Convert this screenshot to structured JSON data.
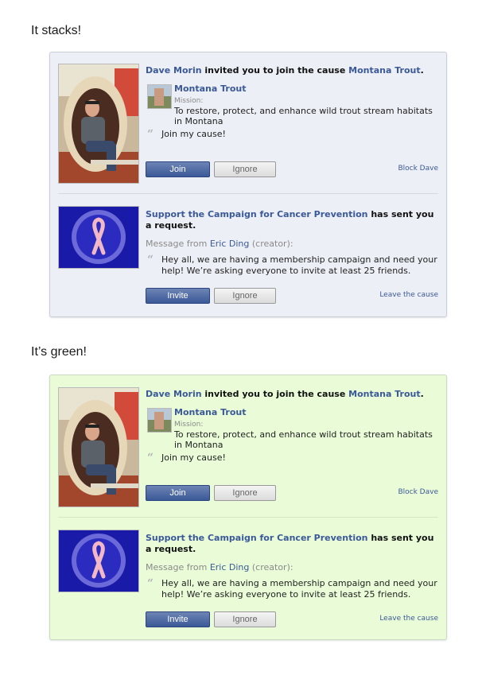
{
  "sections": [
    {
      "title": "It stacks!",
      "request1": {
        "inviter": "Dave Morin",
        "invite_text": " invited you to join the cause ",
        "cause_link": "Montana Trout",
        "cause_name": "Montana Trout",
        "mission_label": "Mission:",
        "mission_text": "To restore, protect, and enhance wild trout stream habitats in Montana",
        "quote": "Join my cause!",
        "primary_button": "Join",
        "secondary_button": "Ignore",
        "side_link": "Block Dave"
      },
      "request2": {
        "cause_link": "Support the Campaign for Cancer Prevention",
        "headline_suffix": " has sent you a request.",
        "message_from_prefix": "Message from ",
        "sender": "Eric Ding",
        "message_from_suffix": " (creator):",
        "quote": "Hey all, we are having a membership campaign and need your help! We’re asking everyone to invite at least 25 friends.",
        "primary_button": "Invite",
        "secondary_button": "Ignore",
        "side_link": "Leave the cause"
      }
    },
    {
      "title": "It’s green!",
      "request1": {
        "inviter": "Dave Morin",
        "invite_text": " invited you to join the cause ",
        "cause_link": "Montana Trout",
        "cause_name": "Montana Trout",
        "mission_label": "Mission:",
        "mission_text": "To restore, protect, and enhance wild trout stream habitats in Montana",
        "quote": "Join my cause!",
        "primary_button": "Join",
        "secondary_button": "Ignore",
        "side_link": "Block Dave"
      },
      "request2": {
        "cause_link": "Support the Campaign for Cancer Prevention",
        "headline_suffix": " has sent you a request.",
        "message_from_prefix": "Message from ",
        "sender": "Eric Ding",
        "message_from_suffix": " (creator):",
        "quote": "Hey all, we are having a membership campaign and need your help! We’re asking everyone to invite at least 25 friends.",
        "primary_button": "Invite",
        "secondary_button": "Ignore",
        "side_link": "Leave the cause"
      }
    }
  ],
  "colors": {
    "link": "#3b5998",
    "panel_gray": "#eceff5",
    "panel_green": "#e9fcd7",
    "ribbon": "#f2b8c6",
    "ribbon_bg": "#1a1aa8"
  }
}
